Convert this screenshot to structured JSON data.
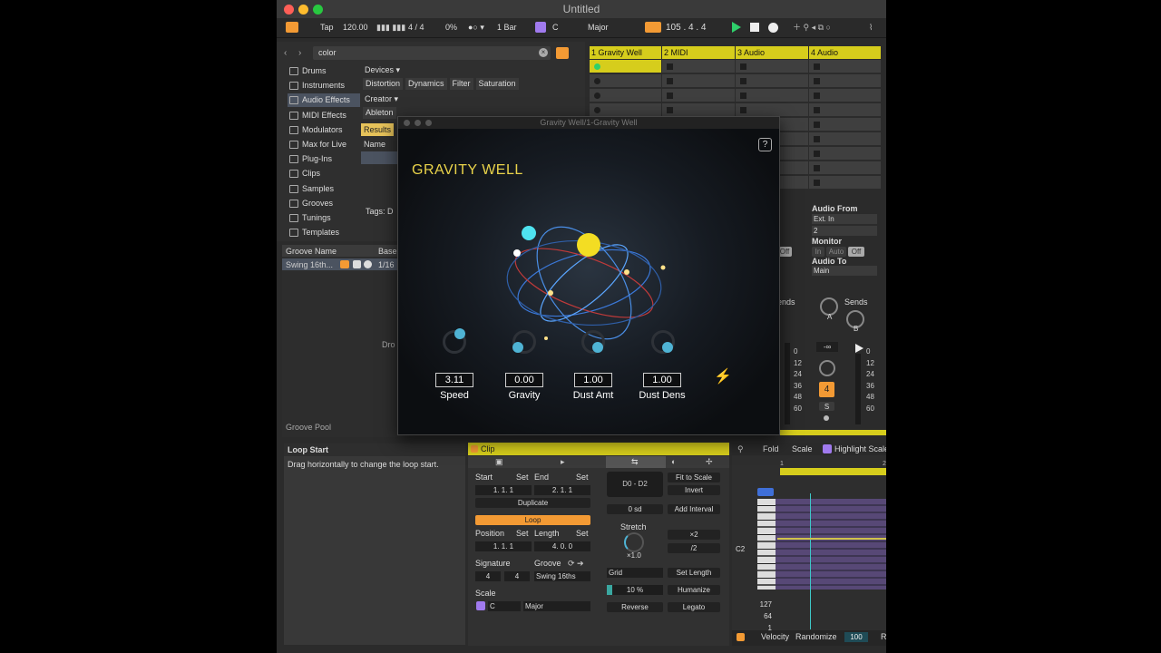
{
  "window": {
    "title": "Untitled"
  },
  "transport": {
    "tap": "Tap",
    "tempo": "120.00",
    "sig": "4 / 4",
    "swing": "0%",
    "quant": "1 Bar",
    "key": "C",
    "scale": "Major",
    "position": "105 .  4 .  4"
  },
  "browser": {
    "search": "color",
    "sidebar": [
      {
        "label": "Drums"
      },
      {
        "label": "Instruments"
      },
      {
        "label": "Audio Effects"
      },
      {
        "label": "MIDI Effects"
      },
      {
        "label": "Modulators"
      },
      {
        "label": "Max for Live"
      },
      {
        "label": "Plug-Ins"
      },
      {
        "label": "Clips"
      },
      {
        "label": "Samples"
      },
      {
        "label": "Grooves"
      },
      {
        "label": "Tunings"
      },
      {
        "label": "Templates"
      }
    ],
    "devices_label": "Devices ▾",
    "device_tags": [
      "Distortion",
      "Dynamics",
      "Filter",
      "Saturation"
    ],
    "creator_label": "Creator ▾",
    "creator_tag": "Ableton",
    "results": "Results",
    "name_col": "Name",
    "tags_label": "Tags: D"
  },
  "groove": {
    "col_name": "Groove Name",
    "col_base": "Base",
    "row_name": "Swing 16th...",
    "row_base": "1/16",
    "drop": "Dro",
    "pool": "Groove Pool"
  },
  "tracks": [
    {
      "name": "1 Gravity Well"
    },
    {
      "name": "2 MIDI"
    },
    {
      "name": "3 Audio"
    },
    {
      "name": "4 Audio"
    }
  ],
  "mixer": {
    "audio_from": "Audio From",
    "ext_in": "Ext. In",
    "input_ch": "2",
    "monitor": "Monitor",
    "mon_in": "In",
    "mon_auto": "Auto",
    "mon_off": "Off",
    "off": "Off",
    "audio_to": "Audio To",
    "main": "Main",
    "sends": "Sends",
    "sends_cut": "ends",
    "a": "A",
    "b": "B",
    "vol": "-∞",
    "meter": [
      "0",
      "12",
      "24",
      "36",
      "48",
      "60"
    ],
    "track_num": "4",
    "solo": "S"
  },
  "plugin": {
    "window_title": "Gravity Well/1-Gravity Well",
    "name": "GRAVITY WELL",
    "help": "?",
    "params": [
      {
        "label": "Speed",
        "value": "3.11",
        "level": 0.55
      },
      {
        "label": "Gravity",
        "value": "0.00",
        "level": 0.0
      },
      {
        "label": "Dust Amt",
        "value": "1.00",
        "level": 0.5
      },
      {
        "label": "Dust Dens",
        "value": "1.00",
        "level": 0.5
      }
    ]
  },
  "info": {
    "title": "Loop Start",
    "text": "Drag horizontally to change the loop start."
  },
  "clip": {
    "title": "Clip",
    "start": "Start",
    "end": "End",
    "set": "Set",
    "start_val": "1.  1.  1",
    "end_val": "2.  1.  1",
    "duplicate": "Duplicate",
    "loop": "Loop",
    "position": "Position",
    "length": "Length",
    "pos_val": "1.  1.  1",
    "len_val": "4.  0.  0",
    "signature": "Signature",
    "groove": "Groove",
    "sig_num": "4",
    "sig_den": "4",
    "groove_val": "Swing 16ths",
    "scale": "Scale",
    "scale_key": "C",
    "scale_name": "Major",
    "range": "D0 - D2",
    "fit": "Fit to Scale",
    "invert": "Invert",
    "semis": "0 sd",
    "add_interval": "Add Interval",
    "stretch": "Stretch",
    "stretch_val": "×1.0",
    "x2": "×2",
    "half": "/2",
    "grid": "Grid",
    "set_length": "Set Length",
    "humanize_val": "10 %",
    "humanize": "Humanize",
    "reverse": "Reverse",
    "legato": "Legato"
  },
  "piano": {
    "fold": "Fold",
    "scale": "Scale",
    "highlight": "Highlight Scale",
    "note": "C2",
    "vel": [
      "127",
      "64",
      "1"
    ],
    "velocity": "Velocity",
    "randomize": "Randomize",
    "vel_val": "100",
    "r": "R",
    "ruler": [
      "1",
      "2"
    ]
  }
}
